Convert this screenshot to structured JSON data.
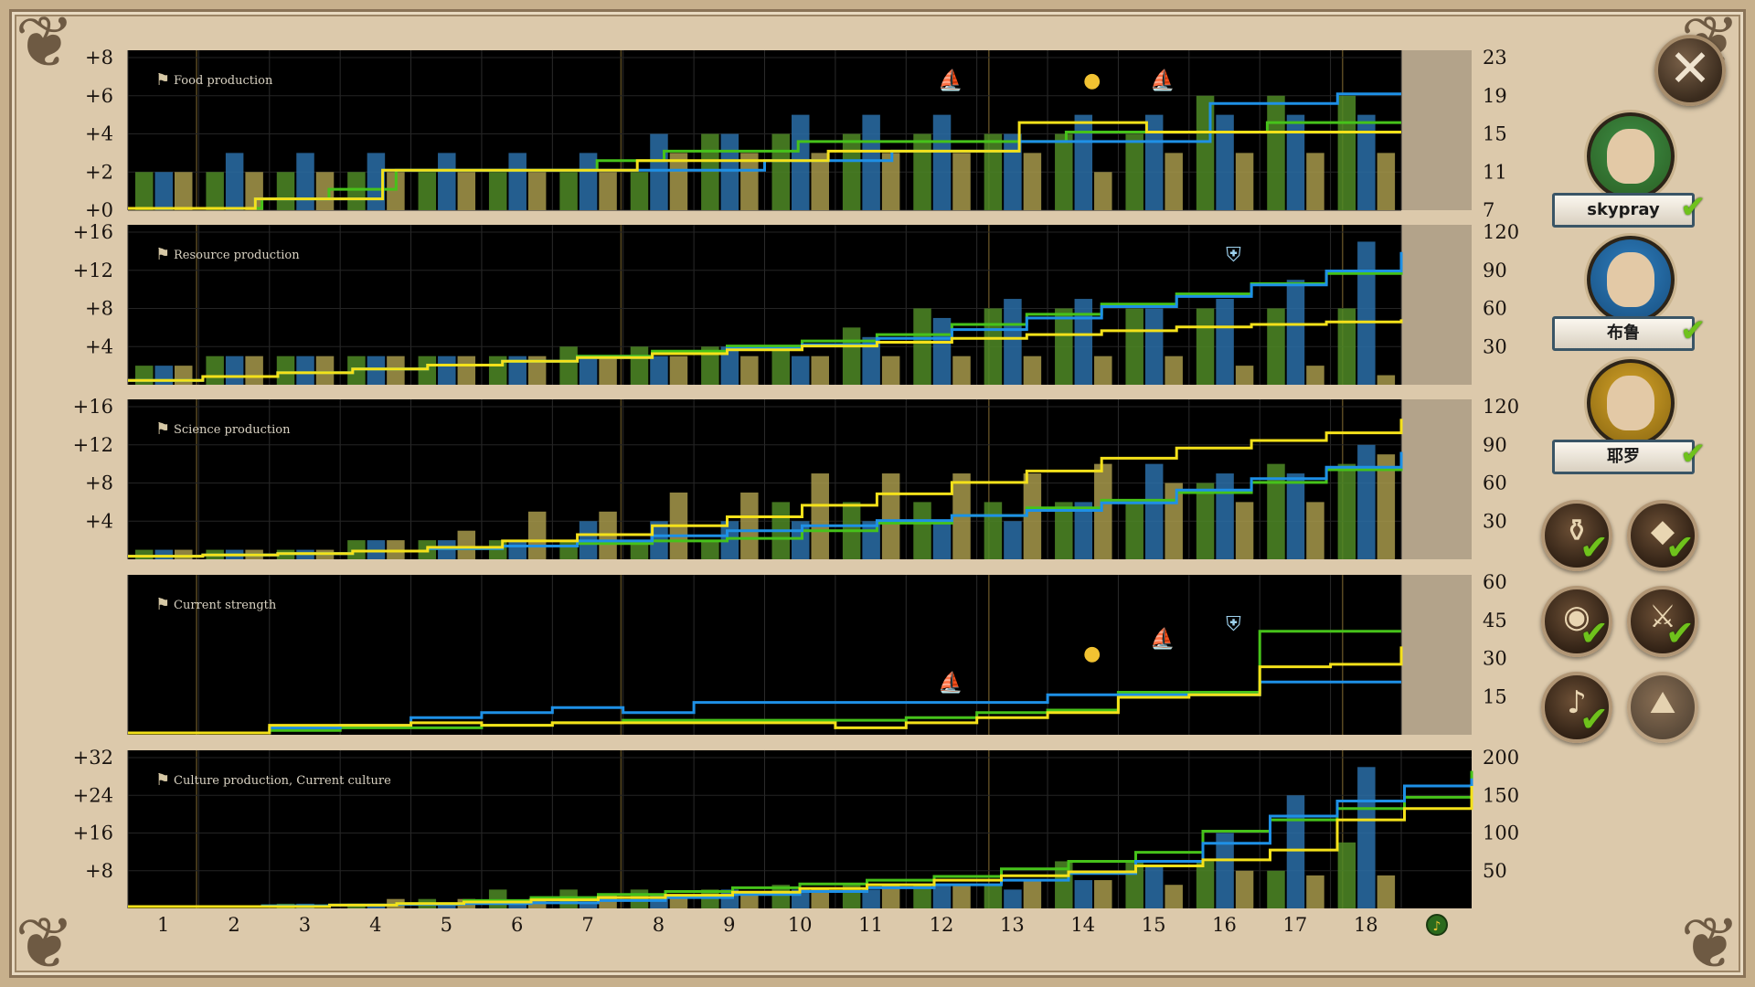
{
  "colors": {
    "green": "#4f8a26",
    "green_line": "#46c21a",
    "blue": "#2a6ea8",
    "blue_line": "#1e90e6",
    "tan": "#a7994b",
    "yellow_line": "#f4e11a",
    "panel_bg": "#000000",
    "future_area": "#b3a38a"
  },
  "turns": [
    "1",
    "2",
    "3",
    "4",
    "5",
    "6",
    "7",
    "8",
    "9",
    "10",
    "11",
    "12",
    "13",
    "14",
    "15",
    "16",
    "17",
    "18"
  ],
  "culture_end_icon": "lyre-icon",
  "players": [
    {
      "name": "skypray",
      "portrait_color": "#3f8f46",
      "ring_color": "#2f6a2b",
      "checked": true
    },
    {
      "name": "布鲁",
      "portrait_color": "#2f7fbf",
      "ring_color": "#1d5a8e",
      "checked": true
    },
    {
      "name": "耶罗",
      "portrait_color": "#d8a62a",
      "ring_color": "#9a7416",
      "checked": true
    }
  ],
  "filter_buttons": [
    {
      "id": "food",
      "icon": "wheat-sack-icon",
      "glyph": "⚱",
      "checked": true
    },
    {
      "id": "resource",
      "icon": "ore-icon",
      "glyph": "◆",
      "checked": true
    },
    {
      "id": "science",
      "icon": "globe-icon",
      "glyph": "◉",
      "checked": true
    },
    {
      "id": "strength",
      "icon": "crossed-swords-icon",
      "glyph": "⚔",
      "checked": true
    },
    {
      "id": "culture",
      "icon": "lyre-icon",
      "glyph": "♪",
      "checked": true
    },
    {
      "id": "wonder",
      "icon": "landscape-icon",
      "glyph": "⛰",
      "checked": false
    }
  ],
  "chart_data": [
    {
      "type": "bar",
      "title": "Food production",
      "icon": "wheat-sack-icon",
      "left_ticks": [
        "+0",
        "+2",
        "+4",
        "+6",
        "+8"
      ],
      "left_ylim": [
        0,
        8
      ],
      "right_ticks": [
        "7",
        "11",
        "15",
        "19",
        "23"
      ],
      "right_ylim": [
        7,
        23
      ],
      "series": [
        {
          "name": "skypray",
          "values": [
            2,
            2,
            2,
            2,
            2,
            2,
            2,
            2,
            4,
            4,
            4,
            4,
            4,
            4,
            4,
            6,
            6,
            6
          ]
        },
        {
          "name": "布鲁",
          "values": [
            2,
            3,
            3,
            3,
            3,
            3,
            3,
            4,
            4,
            5,
            5,
            5,
            4,
            5,
            5,
            5,
            5,
            5
          ]
        },
        {
          "name": "耶罗",
          "values": [
            2,
            2,
            2,
            2,
            2,
            2,
            2,
            3,
            3,
            3,
            3,
            3,
            3,
            2,
            3,
            3,
            3,
            3
          ]
        }
      ],
      "lines": [
        {
          "name": "skypray",
          "values": [
            7,
            7,
            8,
            9,
            11,
            11,
            11,
            12,
            13,
            13,
            14,
            14,
            14,
            14,
            15,
            15,
            15,
            16,
            16,
            16
          ]
        },
        {
          "name": "布鲁",
          "values": [
            7,
            7,
            8,
            8,
            11,
            11,
            11,
            11,
            11,
            11,
            12,
            12,
            13,
            13,
            14,
            14,
            14,
            18,
            18,
            19,
            19
          ]
        },
        {
          "name": "耶罗",
          "values": [
            7,
            7,
            8,
            8,
            11,
            11,
            11,
            11,
            12,
            12,
            12,
            13,
            13,
            13,
            16,
            16,
            15,
            15,
            15,
            15,
            15
          ]
        }
      ],
      "events": [
        {
          "turn": 12,
          "icon": "ship-icon"
        },
        {
          "turn": 14,
          "icon": "gold-coins-icon"
        },
        {
          "turn": 15,
          "icon": "blue-ship-icon"
        }
      ]
    },
    {
      "type": "bar",
      "title": "Resource production",
      "icon": "ore-icon",
      "left_ticks": [
        "+4",
        "+8",
        "+12",
        "+16"
      ],
      "left_ylim": [
        0,
        16
      ],
      "right_ticks": [
        "30",
        "60",
        "90",
        "120"
      ],
      "right_ylim": [
        0,
        120
      ],
      "series": [
        {
          "name": "skypray",
          "values": [
            2,
            3,
            3,
            3,
            3,
            3,
            4,
            4,
            4,
            4,
            6,
            8,
            8,
            8,
            8,
            8,
            8,
            8
          ]
        },
        {
          "name": "布鲁",
          "values": [
            2,
            3,
            3,
            3,
            3,
            3,
            3,
            3,
            4,
            3,
            5,
            7,
            9,
            9,
            8,
            9,
            11,
            15
          ]
        },
        {
          "name": "耶罗",
          "values": [
            2,
            3,
            3,
            3,
            3,
            3,
            3,
            3,
            3,
            3,
            3,
            3,
            3,
            3,
            3,
            2,
            2,
            1
          ]
        }
      ],
      "lines": [
        {
          "name": "skypray",
          "values": [
            2,
            5,
            8,
            11,
            14,
            17,
            21,
            25,
            29,
            33,
            38,
            46,
            54,
            62,
            70,
            78,
            86,
            94
          ]
        },
        {
          "name": "布鲁",
          "values": [
            2,
            5,
            8,
            11,
            14,
            17,
            20,
            23,
            27,
            30,
            35,
            42,
            51,
            60,
            68,
            77,
            88,
            103
          ]
        },
        {
          "name": "耶罗",
          "values": [
            2,
            5,
            8,
            11,
            14,
            17,
            20,
            23,
            26,
            29,
            32,
            35,
            38,
            41,
            44,
            46,
            48,
            50
          ]
        }
      ],
      "events": [
        {
          "turn": 16,
          "icon": "shield-icon"
        }
      ]
    },
    {
      "type": "bar",
      "title": "Science production",
      "icon": "globe-icon",
      "left_ticks": [
        "+4",
        "+8",
        "+12",
        "+16"
      ],
      "left_ylim": [
        0,
        16
      ],
      "right_ticks": [
        "30",
        "60",
        "90",
        "120"
      ],
      "right_ylim": [
        0,
        120
      ],
      "series": [
        {
          "name": "skypray",
          "values": [
            1,
            1,
            1,
            2,
            2,
            2,
            2,
            2,
            2,
            6,
            6,
            6,
            6,
            6,
            6,
            8,
            10,
            10
          ]
        },
        {
          "name": "布鲁",
          "values": [
            1,
            1,
            1,
            2,
            2,
            2,
            4,
            4,
            4,
            4,
            4,
            4,
            4,
            6,
            10,
            9,
            9,
            12
          ]
        },
        {
          "name": "耶罗",
          "values": [
            1,
            1,
            1,
            2,
            3,
            5,
            5,
            7,
            7,
            9,
            9,
            9,
            9,
            10,
            8,
            6,
            6,
            11
          ]
        }
      ],
      "lines": [
        {
          "name": "skypray",
          "values": [
            1,
            2,
            3,
            5,
            7,
            9,
            11,
            13,
            15,
            21,
            27,
            33,
            39,
            45,
            51,
            59,
            69,
            79
          ]
        },
        {
          "name": "布鲁",
          "values": [
            1,
            2,
            3,
            5,
            7,
            9,
            13,
            17,
            21,
            25,
            29,
            33,
            37,
            43,
            53,
            62,
            71,
            83
          ]
        },
        {
          "name": "耶罗",
          "values": [
            1,
            2,
            3,
            5,
            8,
            13,
            18,
            25,
            32,
            41,
            50,
            59,
            68,
            78,
            86,
            92,
            98,
            109
          ]
        }
      ],
      "events": []
    },
    {
      "type": "line",
      "title": "Current strength",
      "icon": "crossed-swords-icon",
      "left_ticks": [],
      "right_ticks": [
        "15",
        "30",
        "45",
        "60"
      ],
      "right_ylim": [
        0,
        60
      ],
      "lines": [
        {
          "name": "skypray",
          "values": [
            0,
            0,
            1,
            2,
            2,
            3,
            4,
            5,
            5,
            5,
            5,
            6,
            8,
            9,
            16,
            16,
            40,
            40,
            40
          ]
        },
        {
          "name": "布鲁",
          "values": [
            0,
            0,
            2,
            3,
            6,
            8,
            10,
            8,
            12,
            12,
            12,
            12,
            12,
            15,
            15,
            15,
            20,
            20,
            20
          ]
        },
        {
          "name": "耶罗",
          "values": [
            0,
            0,
            3,
            3,
            4,
            3,
            4,
            4,
            4,
            4,
            2,
            4,
            6,
            8,
            14,
            15,
            26,
            27,
            34
          ]
        }
      ],
      "events": [
        {
          "turn": 12,
          "icon": "ship-icon"
        },
        {
          "turn": 14,
          "icon": "gold-coins-icon"
        },
        {
          "turn": 15,
          "icon": "blue-ship-icon"
        },
        {
          "turn": 16,
          "icon": "shield-icon"
        }
      ]
    },
    {
      "type": "bar",
      "title": "Culture production, Current culture",
      "icon": "lyre-icon",
      "left_ticks": [
        "+8",
        "+16",
        "+24",
        "+32"
      ],
      "left_ylim": [
        0,
        32
      ],
      "right_ticks": [
        "50",
        "100",
        "150",
        "200"
      ],
      "right_ylim": [
        0,
        200
      ],
      "series": [
        {
          "name": "skypray",
          "values": [
            0,
            0,
            1,
            1,
            2,
            4,
            4,
            4,
            4,
            5,
            5,
            5,
            5,
            10,
            10,
            10,
            8,
            14
          ]
        },
        {
          "name": "布鲁",
          "values": [
            0,
            0,
            1,
            1,
            1,
            1,
            1,
            3,
            4,
            4,
            4,
            5,
            4,
            6,
            9,
            16,
            24,
            30
          ]
        },
        {
          "name": "耶罗",
          "values": [
            0,
            0,
            0,
            2,
            2,
            2,
            3,
            3,
            3,
            4,
            5,
            5,
            6,
            6,
            5,
            8,
            7,
            7
          ]
        }
      ],
      "lines": [
        {
          "name": "skypray",
          "values": [
            0,
            0,
            1,
            2,
            4,
            8,
            12,
            16,
            20,
            25,
            30,
            35,
            40,
            50,
            60,
            72,
            100,
            115,
            130,
            145,
            180
          ]
        },
        {
          "name": "布鲁",
          "values": [
            0,
            0,
            1,
            2,
            3,
            4,
            5,
            8,
            12,
            16,
            20,
            25,
            29,
            35,
            44,
            60,
            84,
            120,
            140,
            160,
            170
          ]
        },
        {
          "name": "耶罗",
          "values": [
            0,
            0,
            0,
            2,
            4,
            6,
            9,
            12,
            15,
            19,
            24,
            29,
            35,
            41,
            46,
            54,
            62,
            75,
            115,
            130,
            160
          ]
        }
      ],
      "events": []
    }
  ]
}
